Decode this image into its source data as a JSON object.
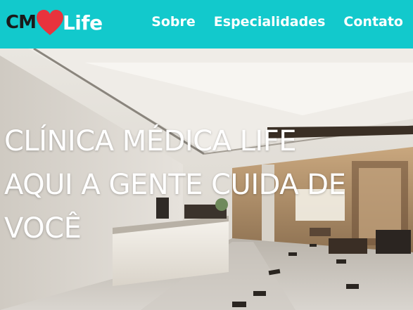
{
  "brand": {
    "logo_prefix": "CM",
    "logo_suffix": "Life",
    "heart_icon": "heart-icon"
  },
  "nav": {
    "items": [
      {
        "label": "Sobre"
      },
      {
        "label": "Especialidades"
      },
      {
        "label": "Contato"
      }
    ]
  },
  "hero": {
    "lines": [
      "CLÍNICA MÉDICA LIFE",
      "AQUI A GENTE CUIDA DE",
      "VOCÊ"
    ]
  },
  "colors": {
    "navbar": "#12c9cc",
    "heart": "#e8333d",
    "text_dark": "#1a1a1a",
    "text_light": "#ffffff"
  }
}
